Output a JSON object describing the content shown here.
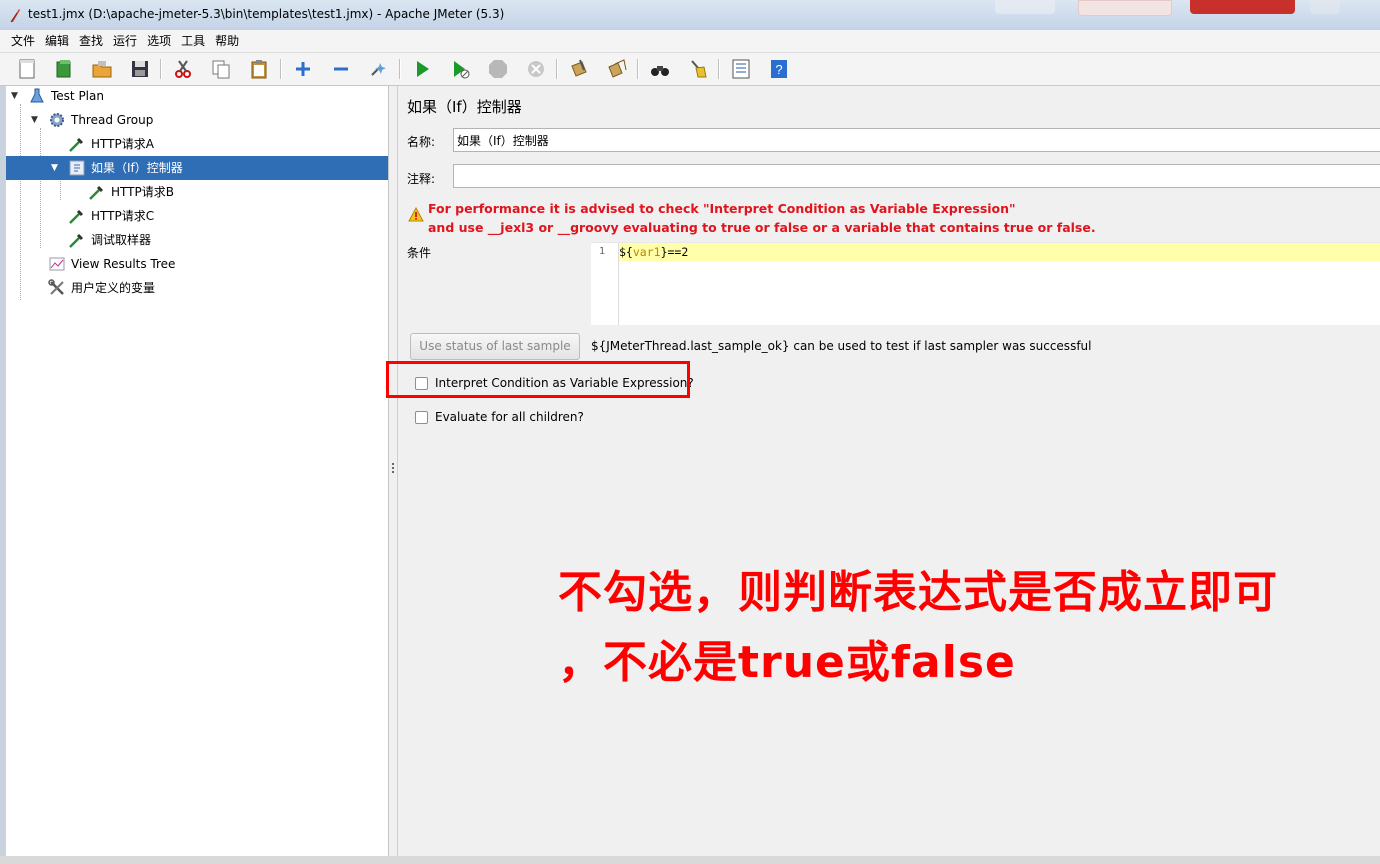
{
  "window": {
    "title": "test1.jmx (D:\\apache-jmeter-5.3\\bin\\templates\\test1.jmx) - Apache JMeter (5.3)"
  },
  "menu": [
    "文件",
    "编辑",
    "查找",
    "运行",
    "选项",
    "工具",
    "帮助"
  ],
  "tree": {
    "test_plan": "Test Plan",
    "thread_group": "Thread Group",
    "http_a": "HTTP请求A",
    "if_controller": "如果（If）控制器",
    "http_b": "HTTP请求B",
    "http_c": "HTTP请求C",
    "debug_sampler": "调试取样器",
    "view_results_tree": "View Results Tree",
    "user_vars": "用户定义的变量"
  },
  "panel": {
    "title": "如果（If）控制器",
    "name_label": "名称:",
    "name_value": "如果（If）控制器",
    "comment_label": "注释:",
    "comment_value": "",
    "warning_line1": "For performance it is advised to check \"Interpret Condition as Variable Expression\"",
    "warning_line2": "and use __jexl3 or __groovy evaluating to true or false or a variable that contains true or false.",
    "condition_label": "条件",
    "editor": {
      "line_number": "1",
      "code_open": "${",
      "code_var": "var1",
      "code_close": "}",
      "code_rest": "==2"
    },
    "use_status_button": "Use status of last sample",
    "hint": "${JMeterThread.last_sample_ok} can be used to test if last sampler was successful",
    "interpret_checkbox": "Interpret Condition as Variable Expression?",
    "evaluate_checkbox": "Evaluate for all children?"
  },
  "annotation": {
    "line1": "不勾选，则判断表达式是否成立即可",
    "line2": "，不必是true或false",
    "color": "#ff0000"
  },
  "colors": {
    "selection": "#2f6eb5",
    "warning": "#e0141c",
    "highlight": "#ffffaa"
  }
}
